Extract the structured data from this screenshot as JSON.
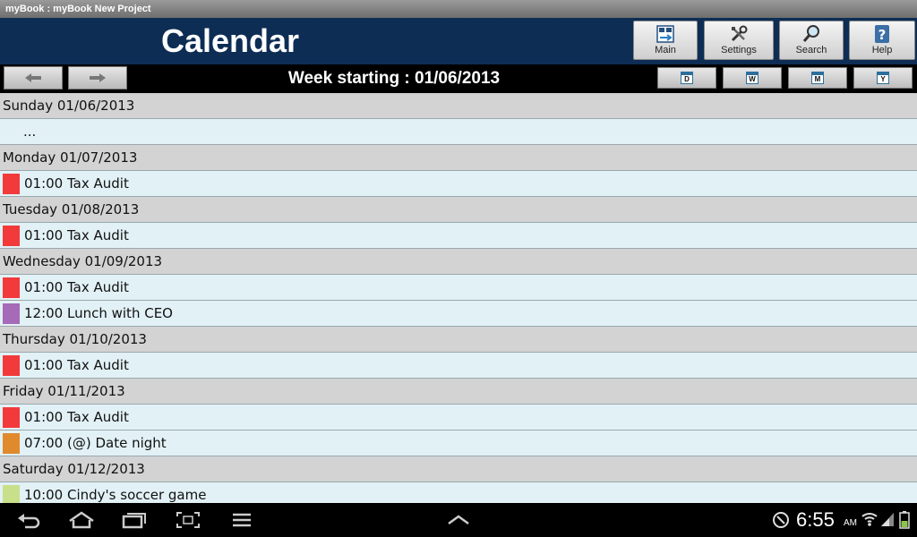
{
  "window": {
    "title": "myBook : myBook New Project"
  },
  "header": {
    "title": "Calendar",
    "buttons": [
      {
        "id": "main",
        "label": "Main",
        "icon": "main-menu-icon"
      },
      {
        "id": "settings",
        "label": "Settings",
        "icon": "tools-icon"
      },
      {
        "id": "search",
        "label": "Search",
        "icon": "magnifier-icon"
      },
      {
        "id": "help",
        "label": "Help",
        "icon": "help-icon"
      }
    ]
  },
  "nav": {
    "week_label": "Week starting : 01/06/2013",
    "prev_icon": "arrow-left-icon",
    "next_icon": "arrow-right-icon",
    "views": [
      {
        "id": "day",
        "letter": "D"
      },
      {
        "id": "week",
        "letter": "W"
      },
      {
        "id": "month",
        "letter": "M"
      },
      {
        "id": "year",
        "letter": "Y"
      }
    ]
  },
  "days": [
    {
      "label": "Sunday 01/06/2013",
      "events": [],
      "empty_text": "..."
    },
    {
      "label": "Monday 01/07/2013",
      "events": [
        {
          "text": "01:00 Tax Audit",
          "color": "#f23a3a"
        }
      ]
    },
    {
      "label": "Tuesday 01/08/2013",
      "events": [
        {
          "text": "01:00 Tax Audit",
          "color": "#f23a3a"
        }
      ]
    },
    {
      "label": "Wednesday 01/09/2013",
      "events": [
        {
          "text": "01:00 Tax Audit",
          "color": "#f23a3a"
        },
        {
          "text": "12:00 Lunch with CEO",
          "color": "#a56ab8"
        }
      ]
    },
    {
      "label": "Thursday 01/10/2013",
      "events": [
        {
          "text": "01:00 Tax Audit",
          "color": "#f23a3a"
        }
      ]
    },
    {
      "label": "Friday 01/11/2013",
      "events": [
        {
          "text": "01:00 Tax Audit",
          "color": "#f23a3a"
        },
        {
          "text": "07:00 (@) Date night",
          "color": "#e08a2e"
        }
      ]
    },
    {
      "label": "Saturday 01/12/2013",
      "events": [
        {
          "text": "10:00 Cindy's soccer game",
          "color": "#c8e08a"
        }
      ]
    }
  ],
  "system_bar": {
    "time": "6:55",
    "ampm": "AM"
  }
}
